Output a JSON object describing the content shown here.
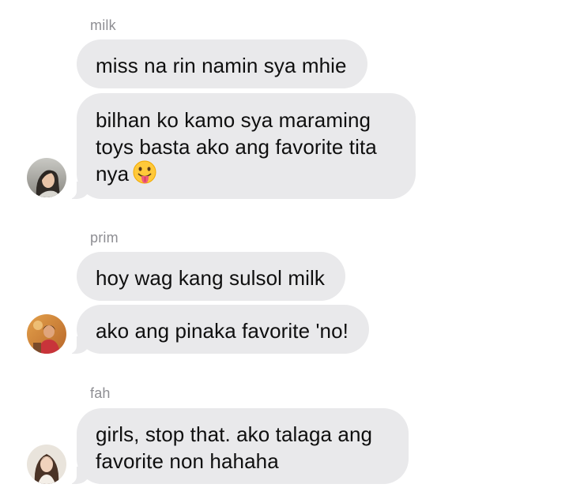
{
  "conversation": {
    "groups": [
      {
        "sender": "milk",
        "messages": [
          {
            "text": "miss na rin namin sya mhie"
          },
          {
            "text": "bilhan ko kamo sya maraming toys basta ako ang favorite tita nya",
            "emoji": "face-with-tongue-emoji"
          }
        ],
        "avatar_icon": "avatar-milk"
      },
      {
        "sender": "prim",
        "messages": [
          {
            "text": "hoy wag kang sulsol milk"
          },
          {
            "text": "ako ang pinaka favorite 'no!"
          }
        ],
        "avatar_icon": "avatar-prim"
      },
      {
        "sender": "fah",
        "messages": [
          {
            "text": "girls, stop that. ako talaga ang favorite non hahaha"
          }
        ],
        "avatar_icon": "avatar-fah"
      }
    ]
  },
  "colors": {
    "background": "#ffffff",
    "bubble": "#e9e9eb",
    "bubble_text": "#0f0f0f",
    "sender_name": "#8e8e93"
  }
}
